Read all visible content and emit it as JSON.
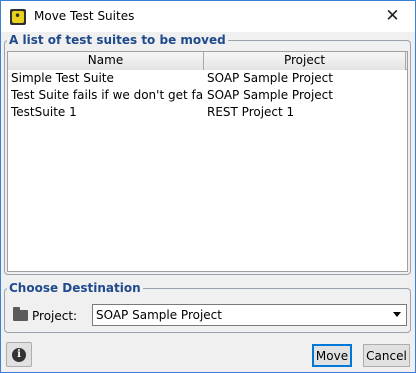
{
  "window": {
    "title": "Move Test Suites",
    "close_glyph": "✕"
  },
  "suites_group": {
    "title": "A list of test suites to be moved",
    "columns": [
      "Name",
      "Project"
    ],
    "rows": [
      {
        "name": "Simple Test Suite",
        "project": "SOAP Sample Project"
      },
      {
        "name": "Test Suite fails if we don't get faults",
        "project": "SOAP Sample Project"
      },
      {
        "name": "TestSuite 1",
        "project": "REST Project 1"
      }
    ]
  },
  "destination_group": {
    "title": "Choose Destination",
    "project_label": "Project:",
    "project_value": "SOAP Sample Project",
    "icon": "folder-icon"
  },
  "buttons": {
    "info_icon": "i",
    "move": "Move",
    "cancel": "Cancel"
  },
  "colors": {
    "accent": "#0078d7",
    "group_title": "#1f4a8c",
    "window_border": "#3b7fd6"
  }
}
